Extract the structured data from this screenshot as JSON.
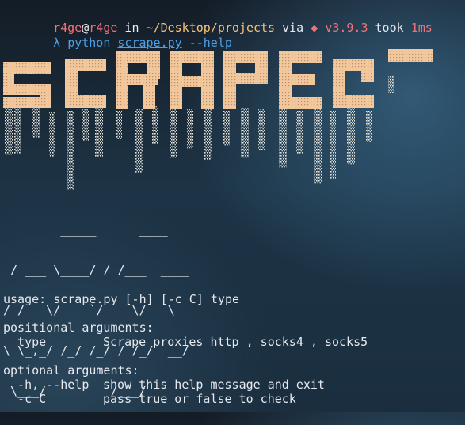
{
  "prompt": {
    "user": "r4ge",
    "at": "@",
    "host": "r4ge",
    "in_word": " in ",
    "path": "~/Desktop/projects",
    "via_word": " via ",
    "python_icon": "python-icon",
    "python_version": "v3.9.3",
    "took_word": " took ",
    "duration": "1ms"
  },
  "command": {
    "arrow": "λ",
    "program": "python",
    "file": "scrape.py",
    "flag": "--help"
  },
  "banner": {
    "glyph_color": "#f2c79b",
    "drip_color": "#e8e3d8"
  },
  "small_art": [
    "        _____      ____",
    " / ___ \\____/ / /___  ____",
    "/ / _ \\/ __ `/ __ \\/ _ \\",
    "\\ \\_,_/ /_/ /_/ / /_/  __/",
    " \\___/         /___/"
  ],
  "help": {
    "usage": "usage: scrape.py [-h] [-c C] type",
    "positional_header": "positional arguments:",
    "positional": [
      {
        "name": "  type",
        "desc": "Scrape proxies http , socks4 , socks5"
      }
    ],
    "optional_header": "optional arguments:",
    "optional": [
      {
        "name": "  -h, --help",
        "desc": "show this help message and exit"
      },
      {
        "name": "  -c C",
        "desc": "pass true or false to check"
      }
    ]
  }
}
